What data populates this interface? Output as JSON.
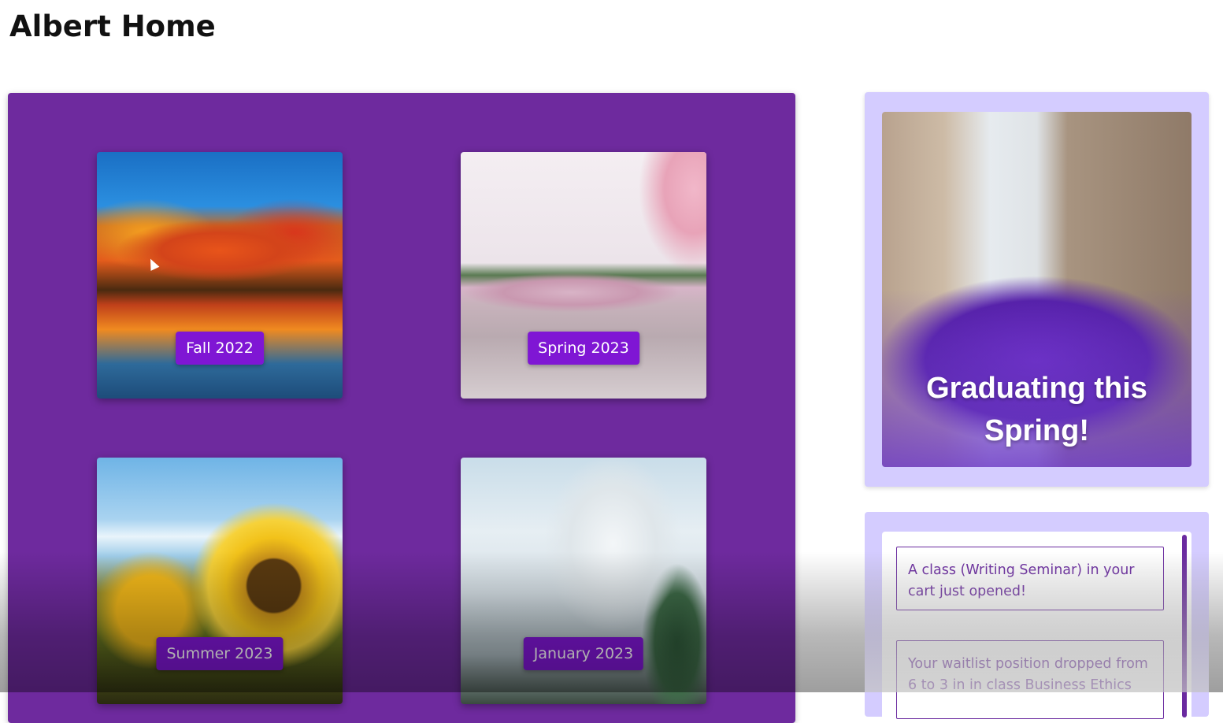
{
  "page": {
    "title": "Albert Home"
  },
  "terms": [
    {
      "label": "Fall 2022"
    },
    {
      "label": "Spring 2023"
    },
    {
      "label": "Summer 2023"
    },
    {
      "label": "January 2023"
    }
  ],
  "promo": {
    "title": "Graduating  this Spring!"
  },
  "notifications": [
    {
      "text": "A class (Writing Seminar) in your cart just opened!"
    },
    {
      "text": "Your waitlist position dropped from 6 to 3 in in class Business Ethics"
    }
  ],
  "colors": {
    "panel": "#6e2a9e",
    "button": "#7f16d4",
    "sidebar": "#d4ccff",
    "notification_border": "#6a2aa0"
  }
}
